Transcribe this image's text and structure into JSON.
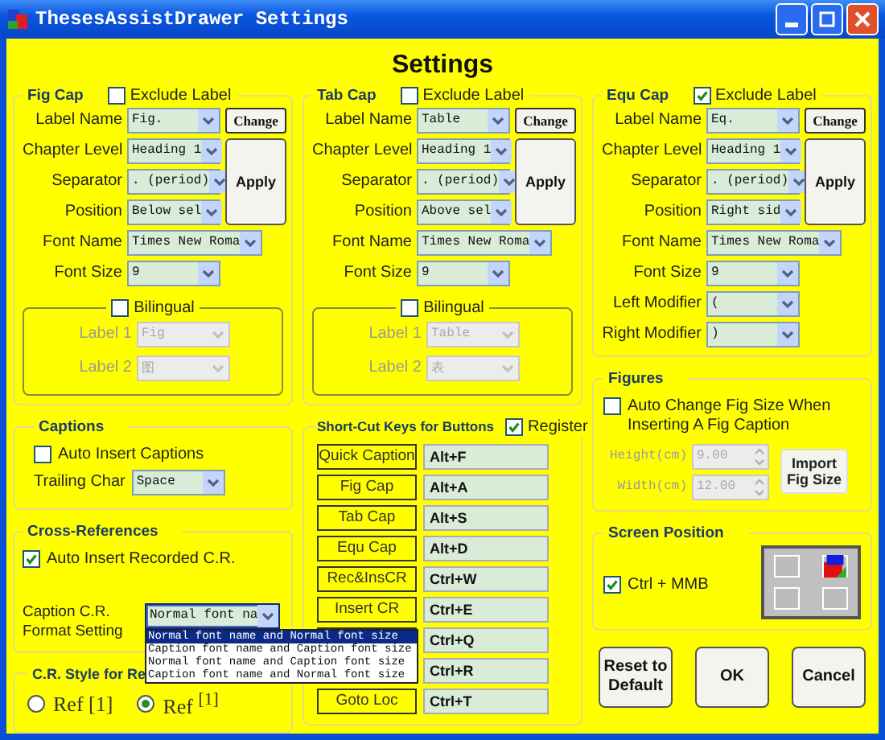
{
  "window": {
    "title": "ThesesAssistDrawer Settings"
  },
  "heading": "Settings",
  "caption_groups": [
    {
      "title": "Fig Cap",
      "exclude_label": {
        "label": "Exclude Label",
        "checked": false
      },
      "change_button": "Change",
      "apply_button": "Apply",
      "fields": [
        {
          "label": "Label Name",
          "value": "Fig.",
          "kind": "combo"
        },
        {
          "label": "Chapter Level",
          "value": "Heading 1",
          "kind": "combo"
        },
        {
          "label": "Separator",
          "value": ". (period)",
          "kind": "combo"
        },
        {
          "label": "Position",
          "value": "Below sel",
          "kind": "combo"
        },
        {
          "label": "Font Name",
          "value": "Times New Roma",
          "kind": "wide_combo"
        },
        {
          "label": "Font Size",
          "value": "9",
          "kind": "combo"
        }
      ],
      "bilingual": {
        "label": "Bilingual",
        "checked": false,
        "fields": [
          {
            "label": "Label 1",
            "value": "Fig",
            "disabled": true
          },
          {
            "label": "Label 2",
            "value": "图",
            "disabled": true
          }
        ]
      }
    },
    {
      "title": "Tab Cap",
      "exclude_label": {
        "label": "Exclude Label",
        "checked": false
      },
      "change_button": "Change",
      "apply_button": "Apply",
      "fields": [
        {
          "label": "Label Name",
          "value": "Table",
          "kind": "combo"
        },
        {
          "label": "Chapter Level",
          "value": "Heading 1",
          "kind": "combo"
        },
        {
          "label": "Separator",
          "value": ". (period)",
          "kind": "combo"
        },
        {
          "label": "Position",
          "value": "Above sel",
          "kind": "combo"
        },
        {
          "label": "Font Name",
          "value": "Times New Roma",
          "kind": "wide_combo"
        },
        {
          "label": "Font Size",
          "value": "9",
          "kind": "combo"
        }
      ],
      "bilingual": {
        "label": "Bilingual",
        "checked": false,
        "fields": [
          {
            "label": "Label 1",
            "value": "Table",
            "disabled": true
          },
          {
            "label": "Label 2",
            "value": "表",
            "disabled": true
          }
        ]
      }
    },
    {
      "title": "Equ Cap",
      "exclude_label": {
        "label": "Exclude Label",
        "checked": true
      },
      "change_button": "Change",
      "apply_button": "Apply",
      "fields": [
        {
          "label": "Label Name",
          "value": "Eq.",
          "kind": "combo"
        },
        {
          "label": "Chapter Level",
          "value": "Heading 1",
          "kind": "combo"
        },
        {
          "label": "Separator",
          "value": ". (period)",
          "kind": "combo"
        },
        {
          "label": "Position",
          "value": "Right sid",
          "kind": "combo"
        },
        {
          "label": "Font Name",
          "value": "Times New Roma",
          "kind": "wide_combo"
        },
        {
          "label": "Font Size",
          "value": "9",
          "kind": "combo"
        },
        {
          "label": "Left Modifier",
          "value": "(",
          "kind": "combo"
        },
        {
          "label": "Right Modifier",
          "value": ")",
          "kind": "combo"
        }
      ]
    }
  ],
  "captions": {
    "title": "Captions",
    "auto_insert": {
      "label": "Auto Insert Captions",
      "checked": false
    },
    "trailing_char": {
      "label": "Trailing Char",
      "value": "Space"
    }
  },
  "cross_references": {
    "title": "Cross-References",
    "auto_insert": {
      "label": "Auto Insert Recorded C.R.",
      "checked": true
    },
    "format_setting": {
      "label": "Caption C.R. Format Setting",
      "value": "Normal font na",
      "expanded": true,
      "options": [
        {
          "label": "Normal font name and Normal font size",
          "selected": true
        },
        {
          "label": "Caption font name and Caption font size",
          "selected": false
        },
        {
          "label": "Normal font name and Caption font size",
          "selected": false
        },
        {
          "label": "Caption font name and Normal font size",
          "selected": false
        }
      ]
    }
  },
  "cr_style": {
    "title": "C.R. Style for Re",
    "options": [
      {
        "label": "Ref [1]",
        "selected": false
      },
      {
        "label": "Ref $^{[1]}$",
        "selected": true
      }
    ]
  },
  "shortcuts": {
    "title": "Short-Cut Keys for Buttons",
    "register": {
      "label": "Register",
      "checked": true
    },
    "rows": [
      {
        "button": "Quick Caption",
        "key": "Alt+F"
      },
      {
        "button": "Fig Cap",
        "key": "Alt+A"
      },
      {
        "button": "Tab Cap",
        "key": "Alt+S"
      },
      {
        "button": "Equ Cap",
        "key": "Alt+D"
      },
      {
        "button": "Rec&InsCR",
        "key": "Ctrl+W"
      },
      {
        "button": "Insert CR",
        "key": "Ctrl+E"
      },
      {
        "key": "Ctrl+Q"
      },
      {
        "key": "Ctrl+R"
      },
      {
        "button": "Goto Loc",
        "key": "Ctrl+T"
      }
    ]
  },
  "figures": {
    "title": "Figures",
    "auto_change": {
      "label": "Auto Change Fig Size When Inserting A Fig Caption",
      "checked": false
    },
    "size_fields": [
      {
        "label": "Height(cm)",
        "value": "9.00",
        "disabled": true
      },
      {
        "label": "Width(cm)",
        "value": "12.00",
        "disabled": true
      }
    ],
    "import_button": "Import Fig Size"
  },
  "screen_position": {
    "title": "Screen Position",
    "ctrl_mmb": {
      "label": "Ctrl + MMB",
      "checked": true
    },
    "cells": [
      {
        "selected": false
      },
      {
        "selected": true
      },
      {
        "selected": false
      },
      {
        "selected": false
      }
    ]
  },
  "buttons": [
    "Reset to Default",
    "OK",
    "Cancel"
  ]
}
